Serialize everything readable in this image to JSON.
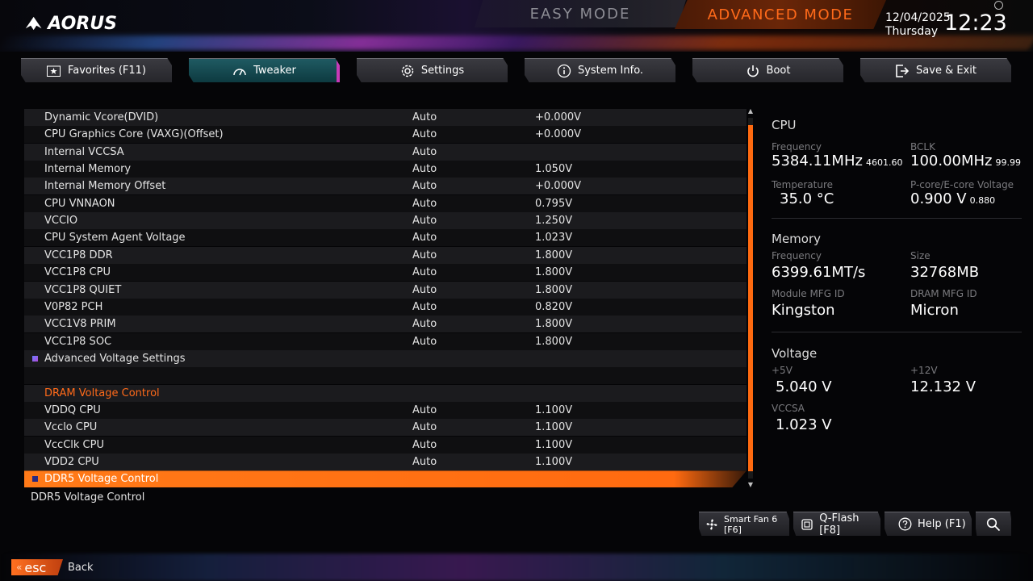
{
  "header": {
    "logo_text": "AORUS",
    "easy_mode": "EASY MODE",
    "advanced_mode": "ADVANCED MODE",
    "date": "12/04/2025",
    "weekday": "Thursday",
    "time": "12:23"
  },
  "tabs": [
    {
      "label": "Favorites (F11)",
      "icon": "star-icon"
    },
    {
      "label": "Tweaker",
      "icon": "speedometer-icon",
      "active": true
    },
    {
      "label": "Settings",
      "icon": "gear-icon"
    },
    {
      "label": "System Info.",
      "icon": "info-icon"
    },
    {
      "label": "Boot",
      "icon": "power-icon"
    },
    {
      "label": "Save & Exit",
      "icon": "exit-icon"
    }
  ],
  "rows": [
    {
      "name": "Dynamic Vcore(DVID)",
      "mode": "Auto",
      "value": "+0.000V"
    },
    {
      "name": "CPU Graphics Core (VAXG)(Offset)",
      "mode": "Auto",
      "value": "+0.000V"
    },
    {
      "name": "Internal VCCSA",
      "mode": "Auto",
      "value": ""
    },
    {
      "name": "Internal Memory",
      "mode": "Auto",
      "value": "1.050V"
    },
    {
      "name": "Internal Memory Offset",
      "mode": "Auto",
      "value": "+0.000V"
    },
    {
      "name": "CPU VNNAON",
      "mode": "Auto",
      "value": "0.795V"
    },
    {
      "name": "VCCIO",
      "mode": "Auto",
      "value": "1.250V"
    },
    {
      "name": "CPU System Agent Voltage",
      "mode": "Auto",
      "value": "1.023V"
    },
    {
      "name": "VCC1P8 DDR",
      "mode": "Auto",
      "value": "1.800V"
    },
    {
      "name": "VCC1P8 CPU",
      "mode": "Auto",
      "value": "1.800V"
    },
    {
      "name": "VCC1P8 QUIET",
      "mode": "Auto",
      "value": "1.800V"
    },
    {
      "name": "V0P82 PCH",
      "mode": "Auto",
      "value": "0.820V"
    },
    {
      "name": "VCC1V8 PRIM",
      "mode": "Auto",
      "value": "1.800V"
    },
    {
      "name": "VCC1P8 SOC",
      "mode": "Auto",
      "value": "1.800V"
    },
    {
      "name": "Advanced Voltage Settings",
      "mode": "",
      "value": "",
      "submenu": true
    },
    {
      "name": "",
      "mode": "",
      "value": ""
    },
    {
      "name": "DRAM Voltage Control",
      "mode": "",
      "value": "",
      "section": true
    },
    {
      "name": "VDDQ CPU",
      "mode": "Auto",
      "value": "1.100V"
    },
    {
      "name": "Vcclo CPU",
      "mode": "Auto",
      "value": "1.100V"
    },
    {
      "name": "VccClk CPU",
      "mode": "Auto",
      "value": "1.100V"
    },
    {
      "name": "VDD2 CPU",
      "mode": "Auto",
      "value": "1.100V"
    },
    {
      "name": "DDR5 Voltage Control",
      "mode": "",
      "value": "",
      "submenu": true,
      "selected": true
    }
  ],
  "scroll": {
    "thumb_start_fraction": 0.02,
    "thumb_end_fraction": 0.98
  },
  "help_text": "DDR5 Voltage Control",
  "info": {
    "cpu": {
      "title": "CPU",
      "frequency_label": "Frequency",
      "frequency": "5384.11MHz",
      "frequency_sub": "4601.60",
      "bclk_label": "BCLK",
      "bclk": "100.00MHz",
      "bclk_sub": "99.99",
      "temperature_label": "Temperature",
      "temperature": "35.0 °C",
      "voltage_label": "P-core/E-core Voltage",
      "voltage": "0.900 V",
      "voltage_sub": "0.880"
    },
    "memory": {
      "title": "Memory",
      "frequency_label": "Frequency",
      "frequency": "6399.61MT/s",
      "size_label": "Size",
      "size": "32768MB",
      "module_label": "Module MFG ID",
      "module": "Kingston",
      "dram_label": "DRAM MFG ID",
      "dram": "Micron"
    },
    "voltage": {
      "title": "Voltage",
      "v5_label": "+5V",
      "v5": "5.040 V",
      "v12_label": "+12V",
      "v12": "12.132 V",
      "vccsa_label": "VCCSA",
      "vccsa": "1.023 V"
    }
  },
  "bottom_buttons": [
    {
      "label": "Smart Fan 6 [F6]",
      "icon": "fan-icon"
    },
    {
      "label": "Q-Flash [F8]",
      "icon": "chip-icon"
    },
    {
      "label": "Help (F1)",
      "icon": "help-icon"
    },
    {
      "label": "",
      "icon": "search-icon"
    }
  ],
  "esc": {
    "key": "esc",
    "label": "Back"
  },
  "colors": {
    "accent": "#ff6a10",
    "active_tab": "#1f5a62",
    "section": "#ff6a1a"
  }
}
